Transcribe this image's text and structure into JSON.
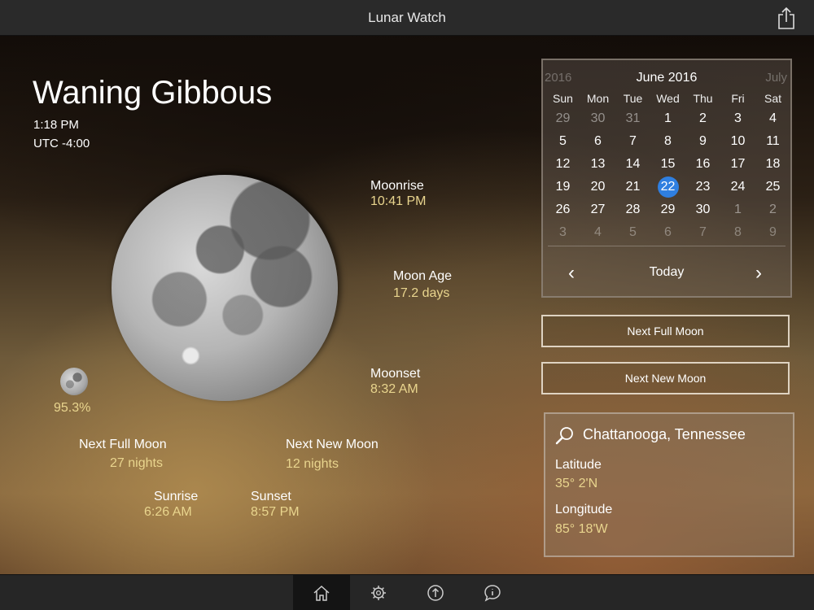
{
  "app": {
    "title": "Lunar Watch"
  },
  "moon": {
    "phase": "Waning Gibbous",
    "time": "1:18 PM",
    "utc": "UTC -4:00",
    "illumination": "95.3%",
    "moonrise_label": "Moonrise",
    "moonrise": "10:41 PM",
    "age_label": "Moon Age",
    "age": "17.2 days",
    "moonset_label": "Moonset",
    "moonset": "8:32 AM",
    "next_full_label": "Next Full Moon",
    "next_full": "27 nights",
    "next_new_label": "Next New Moon",
    "next_new": "12 nights",
    "sunrise_label": "Sunrise",
    "sunrise": "6:26 AM",
    "sunset_label": "Sunset",
    "sunset": "8:57 PM"
  },
  "calendar": {
    "prev_year": "2016",
    "month": "June 2016",
    "next_month": "July",
    "weekdays": [
      "Sun",
      "Mon",
      "Tue",
      "Wed",
      "Thu",
      "Fri",
      "Sat"
    ],
    "days": [
      {
        "d": "29",
        "s": "dim"
      },
      {
        "d": "30",
        "s": "dim"
      },
      {
        "d": "31",
        "s": "dim"
      },
      {
        "d": "1",
        "s": ""
      },
      {
        "d": "2",
        "s": ""
      },
      {
        "d": "3",
        "s": ""
      },
      {
        "d": "4",
        "s": ""
      },
      {
        "d": "5",
        "s": ""
      },
      {
        "d": "6",
        "s": ""
      },
      {
        "d": "7",
        "s": ""
      },
      {
        "d": "8",
        "s": ""
      },
      {
        "d": "9",
        "s": ""
      },
      {
        "d": "10",
        "s": ""
      },
      {
        "d": "11",
        "s": ""
      },
      {
        "d": "12",
        "s": ""
      },
      {
        "d": "13",
        "s": ""
      },
      {
        "d": "14",
        "s": ""
      },
      {
        "d": "15",
        "s": ""
      },
      {
        "d": "16",
        "s": ""
      },
      {
        "d": "17",
        "s": ""
      },
      {
        "d": "18",
        "s": ""
      },
      {
        "d": "19",
        "s": ""
      },
      {
        "d": "20",
        "s": ""
      },
      {
        "d": "21",
        "s": ""
      },
      {
        "d": "22",
        "s": "sel"
      },
      {
        "d": "23",
        "s": ""
      },
      {
        "d": "24",
        "s": ""
      },
      {
        "d": "25",
        "s": ""
      },
      {
        "d": "26",
        "s": ""
      },
      {
        "d": "27",
        "s": ""
      },
      {
        "d": "28",
        "s": ""
      },
      {
        "d": "29",
        "s": ""
      },
      {
        "d": "30",
        "s": ""
      },
      {
        "d": "1",
        "s": "dim"
      },
      {
        "d": "2",
        "s": "dim"
      },
      {
        "d": "3",
        "s": "dim2"
      },
      {
        "d": "4",
        "s": "dim2"
      },
      {
        "d": "5",
        "s": "dim2"
      },
      {
        "d": "6",
        "s": "dim2"
      },
      {
        "d": "7",
        "s": "dim2"
      },
      {
        "d": "8",
        "s": "dim2"
      },
      {
        "d": "9",
        "s": "dim2"
      }
    ],
    "today_label": "Today",
    "prev_icon": "‹",
    "next_icon": "›",
    "selected_color": "#2f7fe0"
  },
  "buttons": {
    "next_full_moon": "Next Full Moon",
    "next_new_moon": "Next New Moon"
  },
  "location": {
    "city": "Chattanooga, Tennessee",
    "latitude_label": "Latitude",
    "latitude": "35° 2'N",
    "longitude_label": "Longitude",
    "longitude": "85° 18'W"
  },
  "tabs": [
    "home-icon",
    "gear-icon",
    "upload-icon",
    "info-icon"
  ],
  "colors": {
    "accent_text": "#e9d58e"
  }
}
